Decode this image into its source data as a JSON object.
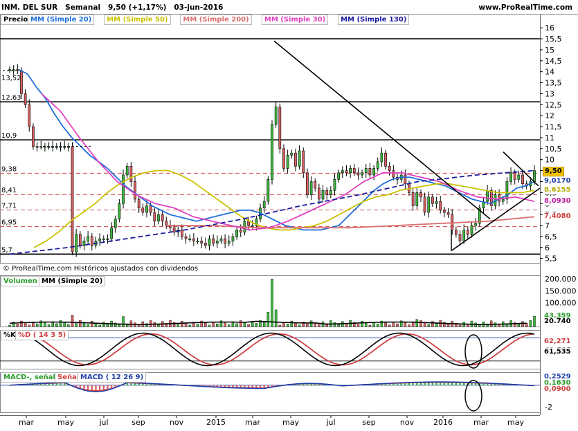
{
  "header": {
    "title": "INM. DEL SUR",
    "period": "Semanal",
    "last": "9,50 (+1,17%)",
    "date": "03-jun-2016",
    "site": "www.ProRealTime.com"
  },
  "price_panel": {
    "label": "Precio",
    "legend": [
      {
        "text": "MM (Simple 20)",
        "color": "#1e6fd9"
      },
      {
        "text": "MM (Simple 50)",
        "color": "#c9c200"
      },
      {
        "text": "MM (Simple 200)",
        "color": "#d97070"
      },
      {
        "text": "MM (Simple 30)",
        "color": "#e040c0"
      },
      {
        "text": "MM (Simple 130)",
        "color": "#1a1aa0"
      }
    ],
    "footer": "© ProRealTime.com  Históricos ajustados con dividendos",
    "level_labels": [
      "13,52",
      "12,63",
      "10,9",
      "9,38",
      "8,41",
      "7,71",
      "6,95",
      "5,7"
    ],
    "tags": [
      {
        "text": "9,50",
        "bg": "#f5c400",
        "fg": "#000000"
      },
      {
        "text": "9,0170",
        "bg": "#ffffff",
        "fg": "#1e3fa8"
      },
      {
        "text": "8,6155",
        "bg": "#ffffff",
        "fg": "#b5ad00"
      },
      {
        "text": "8,0930",
        "bg": "#ffffff",
        "fg": "#c020a0"
      },
      {
        "text": "7,4080",
        "bg": "#ffffff",
        "fg": "#d04040"
      }
    ]
  },
  "volume_panel": {
    "label": "Volumen",
    "legend": "MM (Simple 20)",
    "tags": [
      {
        "text": "43.359",
        "color": "#2a9d2a"
      },
      {
        "text": "20.740",
        "color": "#000000"
      }
    ]
  },
  "stoch_panel": {
    "label": "%K",
    "legend": "%D ( 14 3 5)",
    "tags": [
      {
        "text": "62,271",
        "color": "#d04040"
      },
      {
        "text": "61,535",
        "color": "#000000"
      }
    ]
  },
  "macd_panel": {
    "label": "MACD-, señal",
    "legend2": "Señal",
    "legend3": "MACD ( 12 26 9)",
    "tags": [
      {
        "text": "0,2529",
        "color": "#1e3fa8"
      },
      {
        "text": "0,1630",
        "color": "#2a9d2a"
      },
      {
        "text": "0,0900",
        "color": "#d04040"
      }
    ]
  },
  "colors": {
    "up": "#3cb83c",
    "down": "#d96060",
    "ma20": "#1e6fd9",
    "ma50": "#c9c200",
    "ma200": "#d97070",
    "ma30": "#e040c0",
    "ma130": "#1a1aa0",
    "resistance": "#000000",
    "dashed": "#d04040"
  },
  "chart_data": [
    {
      "type": "candlestick",
      "title": "INM. DEL SUR Semanal",
      "x_ticks": [
        "mar",
        "may",
        "jul",
        "sep",
        "nov",
        "2015",
        "mar",
        "may",
        "jul",
        "sep",
        "nov",
        "2016",
        "mar",
        "may"
      ],
      "y_ticks": [
        5.5,
        6,
        6.5,
        7,
        7.5,
        8,
        8.5,
        9,
        9.5,
        10,
        10.5,
        11,
        11.5,
        12,
        12.5,
        13,
        13.5,
        14,
        14.5,
        15,
        15.5,
        16
      ],
      "y_tick_labels": [
        "5,5",
        "6",
        "6,5",
        "7",
        "7,5",
        "8",
        "8,5",
        "9",
        "9,5",
        "10",
        "10,5",
        "11",
        "11,5",
        "12",
        "12,5",
        "13",
        "13,5",
        "14",
        "14,5",
        "15",
        "15,5",
        "16"
      ],
      "ylim": [
        5.3,
        16.1
      ],
      "horizontal_levels": [
        13.52,
        12.63,
        10.9,
        9.38,
        8.41,
        7.71,
        6.95,
        5.7,
        15.5
      ],
      "close_sequence": [
        14.1,
        14.1,
        14.05,
        13.0,
        12.5,
        11.5,
        10.6,
        10.6,
        10.6,
        10.6,
        10.6,
        10.6,
        10.6,
        10.6,
        10.6,
        10.6,
        5.8,
        6.6,
        6.1,
        6.3,
        6.5,
        6.1,
        6.3,
        6.4,
        6.4,
        6.4,
        6.9,
        7.3,
        8.0,
        9.3,
        9.7,
        9.0,
        8.2,
        7.8,
        7.6,
        7.9,
        7.6,
        7.2,
        7.5,
        7.2,
        7.0,
        6.9,
        6.7,
        6.8,
        6.5,
        6.4,
        6.4,
        6.3,
        6.3,
        6.2,
        6.1,
        6.4,
        6.2,
        6.3,
        6.4,
        6.2,
        6.3,
        6.5,
        6.8,
        6.7,
        7.2,
        7.0,
        7.0,
        7.3,
        7.8,
        8.1,
        9.1,
        11.6,
        12.4,
        10.5,
        9.6,
        10.2,
        10.3,
        9.7,
        10.4,
        9.4,
        8.4,
        9.0,
        8.7,
        8.2,
        8.6,
        8.4,
        8.6,
        9.1,
        9.4,
        9.5,
        9.4,
        9.6,
        9.4,
        9.3,
        9.4,
        9.6,
        9.3,
        9.6,
        9.9,
        10.3,
        9.7,
        9.5,
        9.2,
        9.1,
        9.3,
        8.9,
        8.5,
        7.9,
        8.5,
        8.3,
        7.6,
        8.3,
        8.0,
        8.1,
        7.7,
        7.6,
        7.5,
        6.8,
        6.6,
        6.3,
        6.8,
        6.6,
        7.0,
        7.1,
        7.8,
        8.1,
        8.6,
        7.9,
        8.4,
        8.1,
        8.2,
        9.0,
        9.4,
        9.1,
        9.3,
        8.9,
        8.8,
        9.0,
        9.5
      ],
      "series": [
        {
          "name": "MM (Simple 20)",
          "values": [
            null,
            14.1,
            13.9,
            13.3,
            12.8,
            12.1,
            11.5,
            11.0,
            10.6,
            10.2,
            9.9,
            9.6,
            9.2,
            8.8,
            8.5,
            8.2,
            7.9,
            7.7,
            7.5,
            7.4,
            7.3,
            7.2,
            7.3,
            7.4,
            7.5,
            7.6,
            7.7,
            7.7,
            7.6,
            7.4,
            7.2,
            7.0,
            6.9,
            6.8,
            6.8,
            6.8,
            6.9,
            7.0,
            7.4,
            7.8,
            8.2,
            8.6,
            8.9,
            9.1,
            9.2,
            9.2,
            9.1,
            9.0,
            8.9,
            8.8,
            8.6,
            8.4,
            8.2,
            8.1,
            8.0,
            8.2,
            8.4,
            8.7,
            8.8,
            9.0
          ]
        },
        {
          "name": "MM (Simple 50)",
          "values": [
            null,
            null,
            6.0,
            6.3,
            6.7,
            7.2,
            7.6,
            8.0,
            8.5,
            8.9,
            9.2,
            9.4,
            9.5,
            9.5,
            9.3,
            9.0,
            8.6,
            8.2,
            7.8,
            7.4,
            7.1,
            6.9,
            6.8,
            6.8,
            6.9,
            7.0,
            7.2,
            7.5,
            7.8,
            8.1,
            8.3,
            8.4,
            8.6,
            8.7,
            8.8,
            8.9,
            8.9,
            8.8,
            8.7,
            8.6,
            8.5,
            8.5,
            8.5,
            8.6
          ]
        },
        {
          "name": "MM (Simple 200)",
          "values": [
            7.0,
            7.0,
            6.9,
            6.9,
            6.9,
            7.0,
            7.1,
            7.2,
            7.4
          ]
        },
        {
          "name": "MM (Simple 30)",
          "values": [
            13.0,
            12.2,
            11.0,
            9.9,
            9.0,
            8.4,
            8.0,
            7.8,
            7.4,
            7.2,
            7.0,
            6.8,
            6.9,
            7.2,
            7.6,
            8.0,
            8.4,
            9.0,
            9.4,
            9.4,
            9.2,
            9.0,
            8.6,
            8.3,
            8.2,
            8.3,
            8.1
          ]
        },
        {
          "name": "MM (Simple 130)",
          "values": [
            5.7,
            6.0,
            6.4,
            6.8,
            7.3,
            7.9,
            8.4,
            9.0,
            9.3,
            9.5
          ]
        }
      ]
    },
    {
      "type": "bar",
      "title": "Volumen",
      "y_ticks": [
        20740,
        43359,
        100000,
        150000,
        200000
      ],
      "y_tick_labels": [
        "20.740",
        "43.359",
        "100.000",
        "150.000",
        "200.000"
      ],
      "ylim": [
        0,
        215000
      ],
      "note_peak": 200000
    },
    {
      "type": "line",
      "title": "%K %D ( 14 3 5)",
      "ylim": [
        0,
        100
      ],
      "y_ticks": [
        62.271,
        61.535
      ],
      "y_tick_labels": [
        "62,271",
        "61,535"
      ]
    },
    {
      "type": "line",
      "title": "MACD ( 12 26 9)",
      "ylim": [
        -2.5,
        1.2
      ],
      "y_ticks": [
        -2
      ],
      "y_tick_labels": [
        "-2"
      ]
    }
  ]
}
